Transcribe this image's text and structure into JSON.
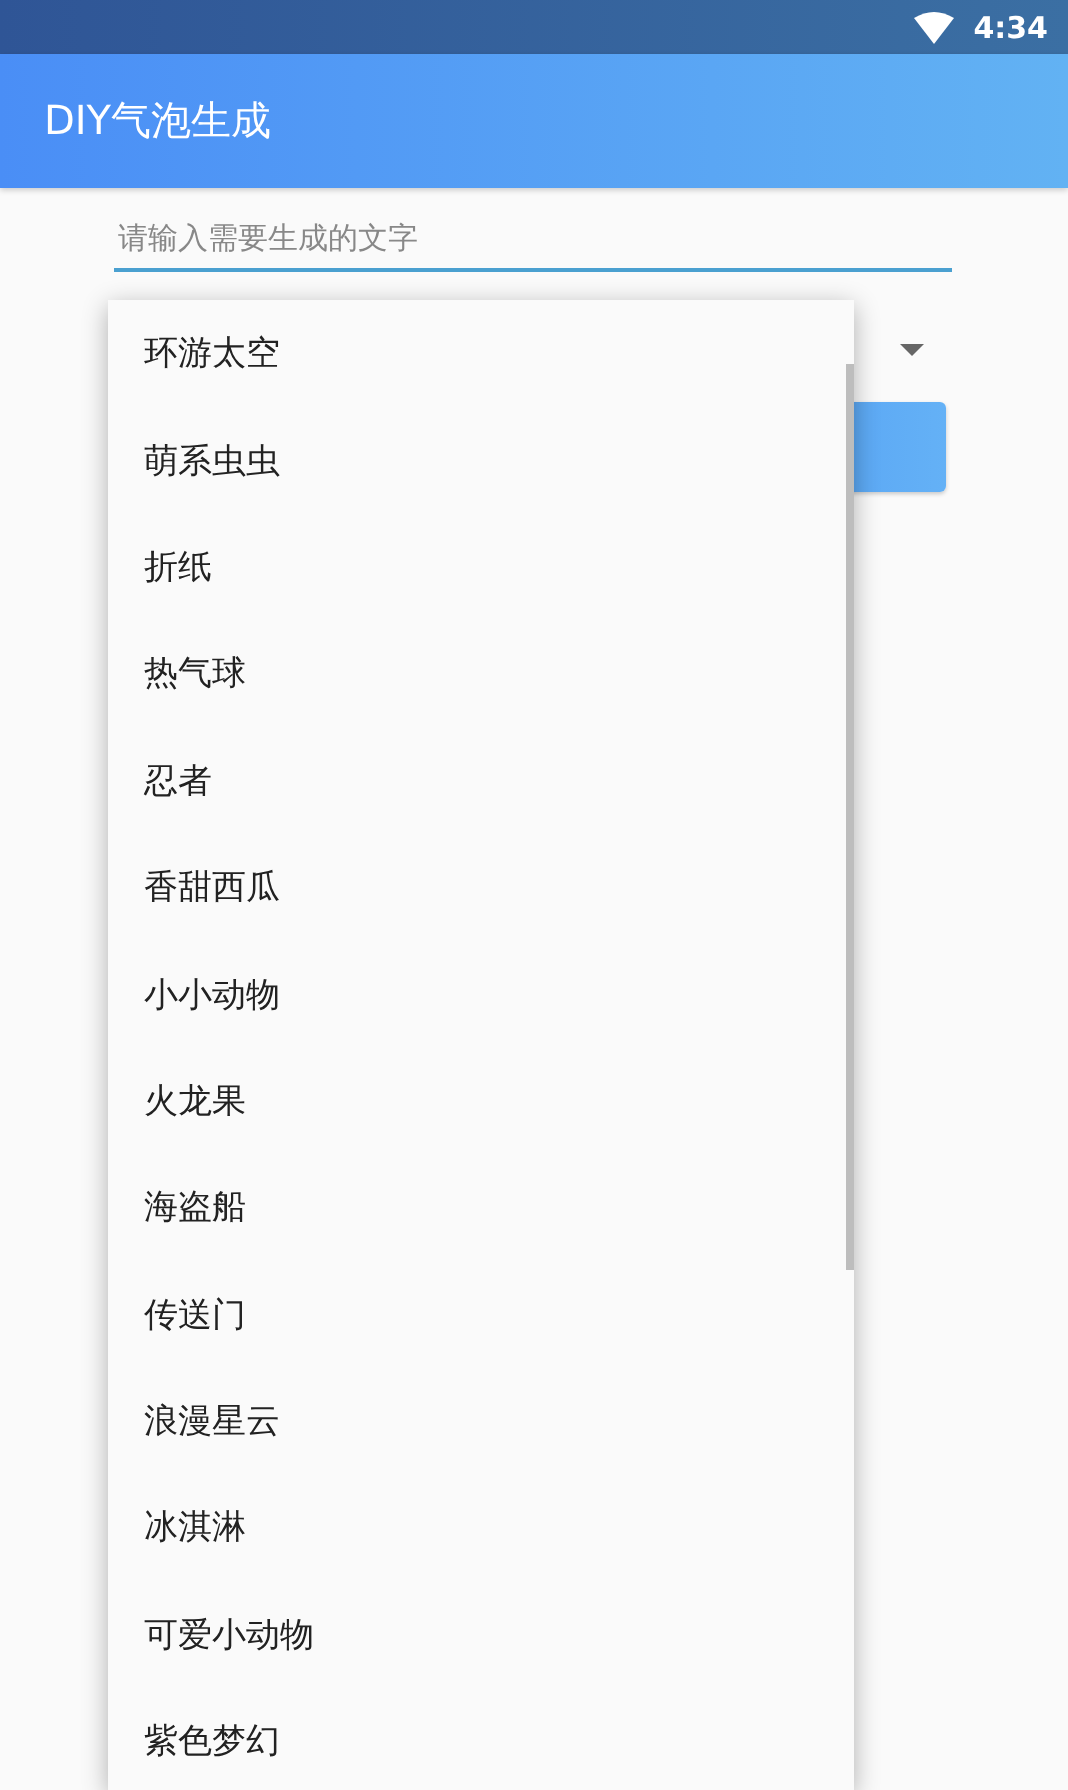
{
  "status_bar": {
    "time": "4:34"
  },
  "app_bar": {
    "title": "DIY气泡生成"
  },
  "text_field": {
    "placeholder": "请输入需要生成的文字"
  },
  "dropdown": {
    "items": [
      {
        "label": "环游太空"
      },
      {
        "label": "萌系虫虫"
      },
      {
        "label": "折纸"
      },
      {
        "label": "热气球"
      },
      {
        "label": "忍者"
      },
      {
        "label": "香甜西瓜"
      },
      {
        "label": "小小动物"
      },
      {
        "label": "火龙果"
      },
      {
        "label": "海盗船"
      },
      {
        "label": "传送门"
      },
      {
        "label": "浪漫星云"
      },
      {
        "label": "冰淇淋"
      },
      {
        "label": "可爱小动物"
      },
      {
        "label": "紫色梦幻"
      }
    ]
  }
}
